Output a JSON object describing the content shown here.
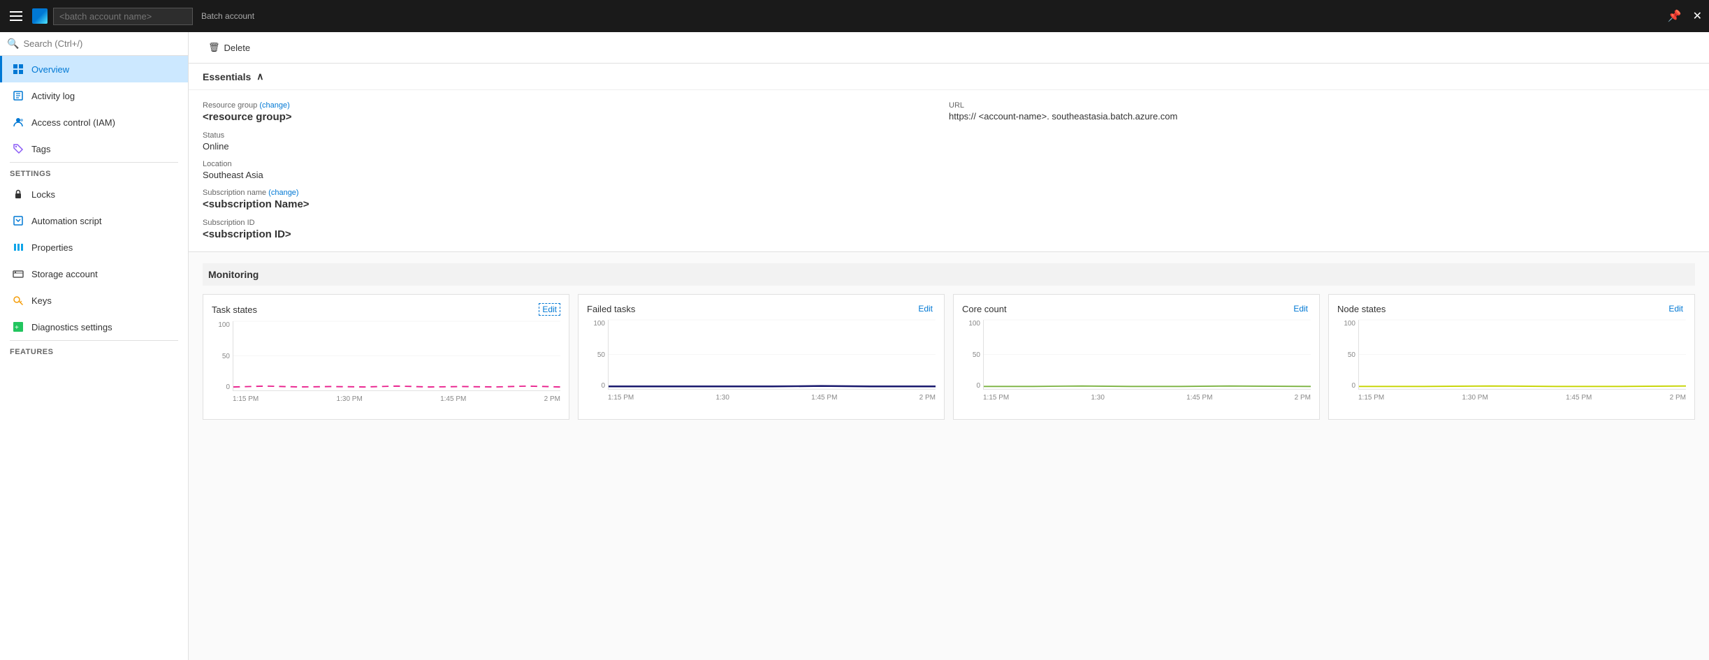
{
  "topbar": {
    "batch_name_placeholder": "<batch account name>",
    "batch_label": "Batch account",
    "close_label": "✕",
    "pin_label": "📌"
  },
  "search": {
    "placeholder": "Search (Ctrl+/)"
  },
  "sidebar": {
    "overview_label": "Overview",
    "activity_log_label": "Activity log",
    "access_control_label": "Access control (IAM)",
    "tags_label": "Tags",
    "settings_section": "SETTINGS",
    "locks_label": "Locks",
    "automation_script_label": "Automation script",
    "properties_label": "Properties",
    "storage_account_label": "Storage account",
    "keys_label": "Keys",
    "diagnostics_label": "Diagnostics settings",
    "features_section": "FEATURES"
  },
  "toolbar": {
    "delete_label": "Delete"
  },
  "essentials": {
    "header": "Essentials",
    "resource_group_label": "Resource group",
    "resource_group_change": "(change)",
    "resource_group_value": "<resource group>",
    "status_label": "Status",
    "status_value": "Online",
    "location_label": "Location",
    "location_value": "Southeast Asia",
    "subscription_name_label": "Subscription name",
    "subscription_name_change": "(change)",
    "subscription_name_value": "<subscription Name>",
    "subscription_id_label": "Subscription ID",
    "subscription_id_value": "<subscription ID>",
    "url_label": "URL",
    "url_value": "https://  <account-name>.  southeastasia.batch.azure.com"
  },
  "monitoring": {
    "header": "Monitoring",
    "charts": [
      {
        "title": "Task states",
        "edit_label": "Edit",
        "edit_dashed": true,
        "y_labels": [
          "100",
          "50",
          "0"
        ],
        "x_labels": [
          "1:15 PM",
          "1:30 PM",
          "1:45 PM",
          "2 PM"
        ],
        "line_color": "#e91e8c",
        "line_type": "dashed"
      },
      {
        "title": "Failed tasks",
        "edit_label": "Edit",
        "edit_dashed": false,
        "y_labels": [
          "100",
          "50",
          "0"
        ],
        "x_labels": [
          "1:15 PM",
          "1:30",
          "1:45 PM",
          "2 PM"
        ],
        "line_color": "#1a1a6e",
        "line_type": "solid"
      },
      {
        "title": "Core count",
        "edit_label": "Edit",
        "edit_dashed": false,
        "y_labels": [
          "100",
          "50",
          "0"
        ],
        "x_labels": [
          "1:15 PM",
          "1:30",
          "1:45 PM",
          "2 PM"
        ],
        "line_color": "#7cb342",
        "line_type": "solid"
      },
      {
        "title": "Node states",
        "edit_label": "Edit",
        "edit_dashed": false,
        "y_labels": [
          "100",
          "50",
          "0"
        ],
        "x_labels": [
          "1:15 PM",
          "1:30 PM",
          "1:45 PM",
          "2 PM"
        ],
        "line_color": "#c6d400",
        "line_type": "solid"
      }
    ]
  }
}
